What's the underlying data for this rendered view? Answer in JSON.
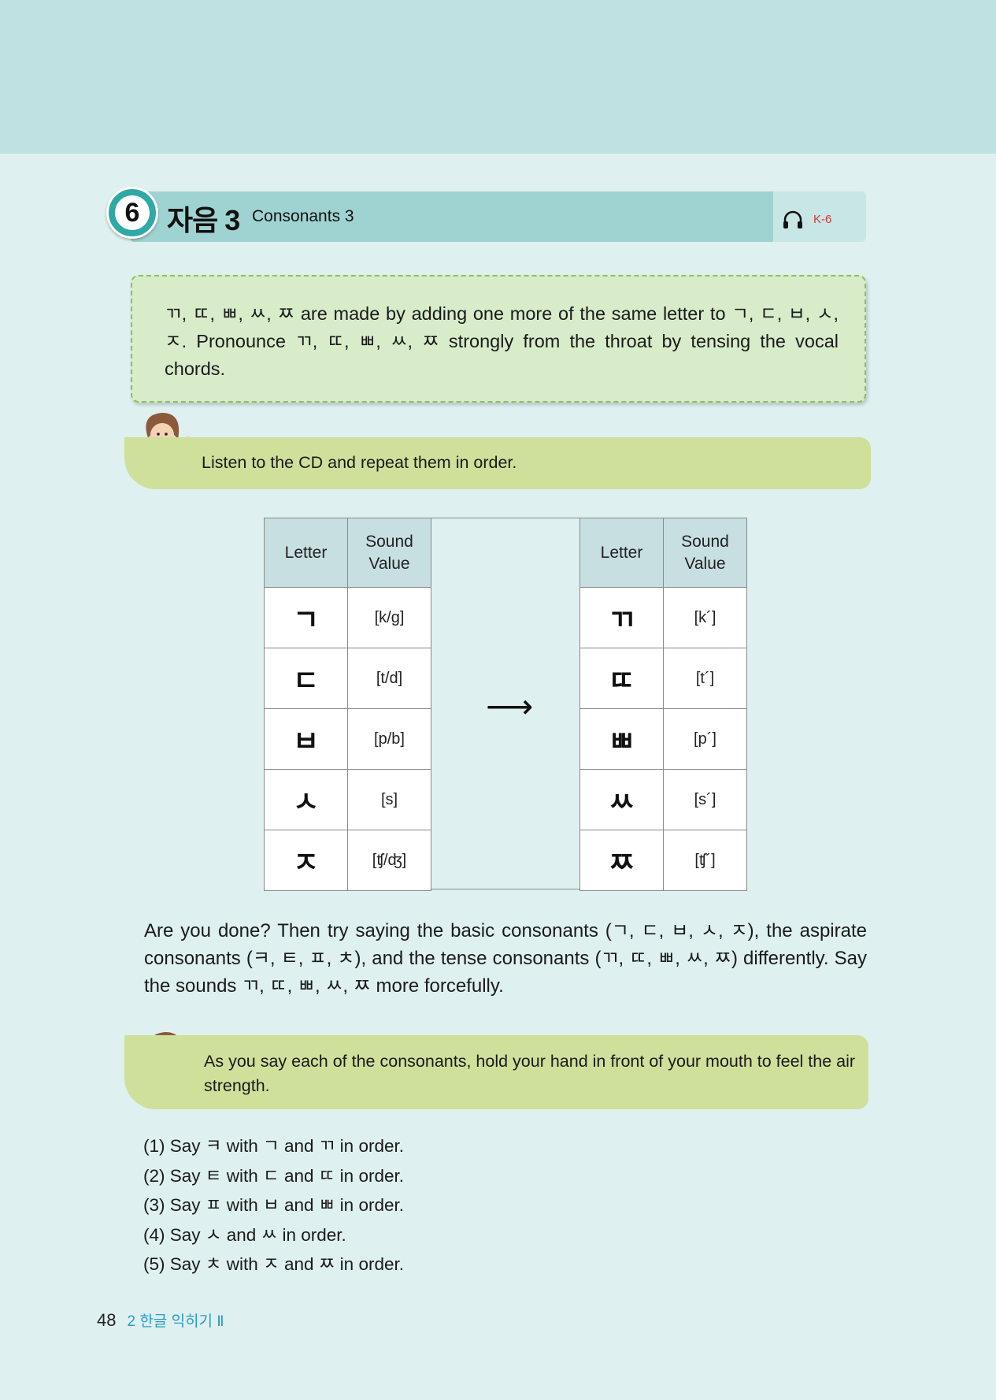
{
  "section": {
    "number": "6",
    "title_ko": "자음 3",
    "title_en": "Consonants 3",
    "audio_track": "K-6"
  },
  "intro": {
    "text": "ㄲ, ㄸ, ㅃ, ㅆ, ㅉ are made by adding one more of the same letter to ㄱ, ㄷ, ㅂ, ㅅ, ㅈ. Pronounce ㄲ, ㄸ, ㅃ, ㅆ, ㅉ strongly from the throat by tensing the vocal chords."
  },
  "instruction1": "Listen to the CD and repeat them in order.",
  "table": {
    "headers": {
      "letter": "Letter",
      "sound": "Sound Value"
    },
    "basic": [
      {
        "letter": "ㄱ",
        "sound": "[k/g]"
      },
      {
        "letter": "ㄷ",
        "sound": "[t/d]"
      },
      {
        "letter": "ㅂ",
        "sound": "[p/b]"
      },
      {
        "letter": "ㅅ",
        "sound": "[s]"
      },
      {
        "letter": "ㅈ",
        "sound": "[ʧ/ʤ]"
      }
    ],
    "arrow": "⟶",
    "tense": [
      {
        "letter": "ㄲ",
        "sound": "[k´]"
      },
      {
        "letter": "ㄸ",
        "sound": "[t´]"
      },
      {
        "letter": "ㅃ",
        "sound": "[p´]"
      },
      {
        "letter": "ㅆ",
        "sound": "[s´]"
      },
      {
        "letter": "ㅉ",
        "sound": "[ʧ´]"
      }
    ]
  },
  "paragraph": "Are you done? Then try saying the basic consonants (ㄱ, ㄷ, ㅂ, ㅅ, ㅈ), the aspirate consonants (ㅋ, ㅌ, ㅍ, ㅊ), and the tense consonants (ㄲ, ㄸ, ㅃ, ㅆ, ㅉ) differently. Say the sounds ㄲ, ㄸ, ㅃ, ㅆ, ㅉ more forcefully.",
  "instruction2": "As you say each of the consonants, hold your hand in front of your mouth to feel the air strength.",
  "exercises": [
    "(1) Say ㅋ with ㄱ and ㄲ in order.",
    "(2) Say ㅌ with ㄷ and ㄸ in order.",
    "(3) Say ㅍ with ㅂ and ㅃ in order.",
    "(4) Say ㅅ and ㅆ in order.",
    "(5) Say ㅊ with ㅈ and ㅉ in order."
  ],
  "footer": {
    "page_number": "48",
    "chapter": "2 한글 익히기 Ⅱ"
  },
  "icons": {
    "audio": "headphones-icon",
    "teacher": "teacher-illustration"
  }
}
